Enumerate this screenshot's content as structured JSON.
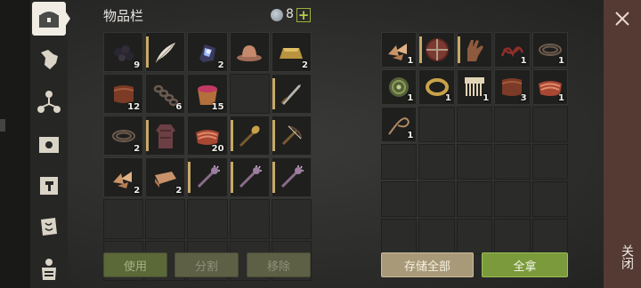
{
  "inventory": {
    "title": "物品栏",
    "weight": "8",
    "add_button": "+",
    "slots": [
      {
        "icon": "berries-icon",
        "count": "9"
      },
      {
        "icon": "feather-quill-icon",
        "count": "",
        "bar": true
      },
      {
        "icon": "crystal-ore-icon",
        "count": "2"
      },
      {
        "icon": "leather-hat-icon",
        "count": ""
      },
      {
        "icon": "gold-ingot-icon",
        "count": "2"
      },
      {
        "icon": "leather-hide-icon",
        "count": "12"
      },
      {
        "icon": "rope-chain-icon",
        "count": "6"
      },
      {
        "icon": "berry-bucket-icon",
        "count": "15"
      },
      {
        "icon": "",
        "count": ""
      },
      {
        "icon": "short-sword-icon",
        "count": "",
        "bar": true
      },
      {
        "icon": "rope-coil-icon",
        "count": "2"
      },
      {
        "icon": "leather-tunic-icon",
        "count": "",
        "bar": true
      },
      {
        "icon": "raw-meat-icon",
        "count": "20"
      },
      {
        "icon": "torch-icon",
        "count": "",
        "bar": true
      },
      {
        "icon": "crossbow-icon",
        "count": "",
        "bar": true
      },
      {
        "icon": "wood-chips-icon",
        "count": "2"
      },
      {
        "icon": "folded-cloth-icon",
        "count": "2"
      },
      {
        "icon": "spiked-mace-icon",
        "count": "",
        "bar": true
      },
      {
        "icon": "spiked-mace-icon",
        "count": "",
        "bar": true
      },
      {
        "icon": "spiked-mace-icon",
        "count": "",
        "bar": true
      }
    ],
    "buttons": {
      "use": "使用",
      "split": "分割",
      "remove": "移除"
    }
  },
  "storage": {
    "slots": [
      {
        "icon": "wood-chips-icon",
        "count": "1"
      },
      {
        "icon": "round-shield-icon",
        "count": "",
        "bar": true
      },
      {
        "icon": "leather-glove-icon",
        "count": "",
        "bar": true
      },
      {
        "icon": "red-rope-icon",
        "count": "1"
      },
      {
        "icon": "rope-coil-icon",
        "count": "1"
      },
      {
        "icon": "green-orb-icon",
        "count": "1"
      },
      {
        "icon": "gold-ring-icon",
        "count": "1"
      },
      {
        "icon": "bone-comb-icon",
        "count": "1"
      },
      {
        "icon": "leather-hide-icon",
        "count": "3"
      },
      {
        "icon": "raw-meat-icon",
        "count": "1"
      },
      {
        "icon": "whip-icon",
        "count": "1"
      }
    ],
    "buttons": {
      "store_all": "存储全部",
      "take_all": "全拿"
    }
  },
  "close": {
    "label": "关闭"
  },
  "colors": {
    "accent_green": "#7a9a3c",
    "store_tan": "#a89a78",
    "close_red": "#543a33"
  }
}
